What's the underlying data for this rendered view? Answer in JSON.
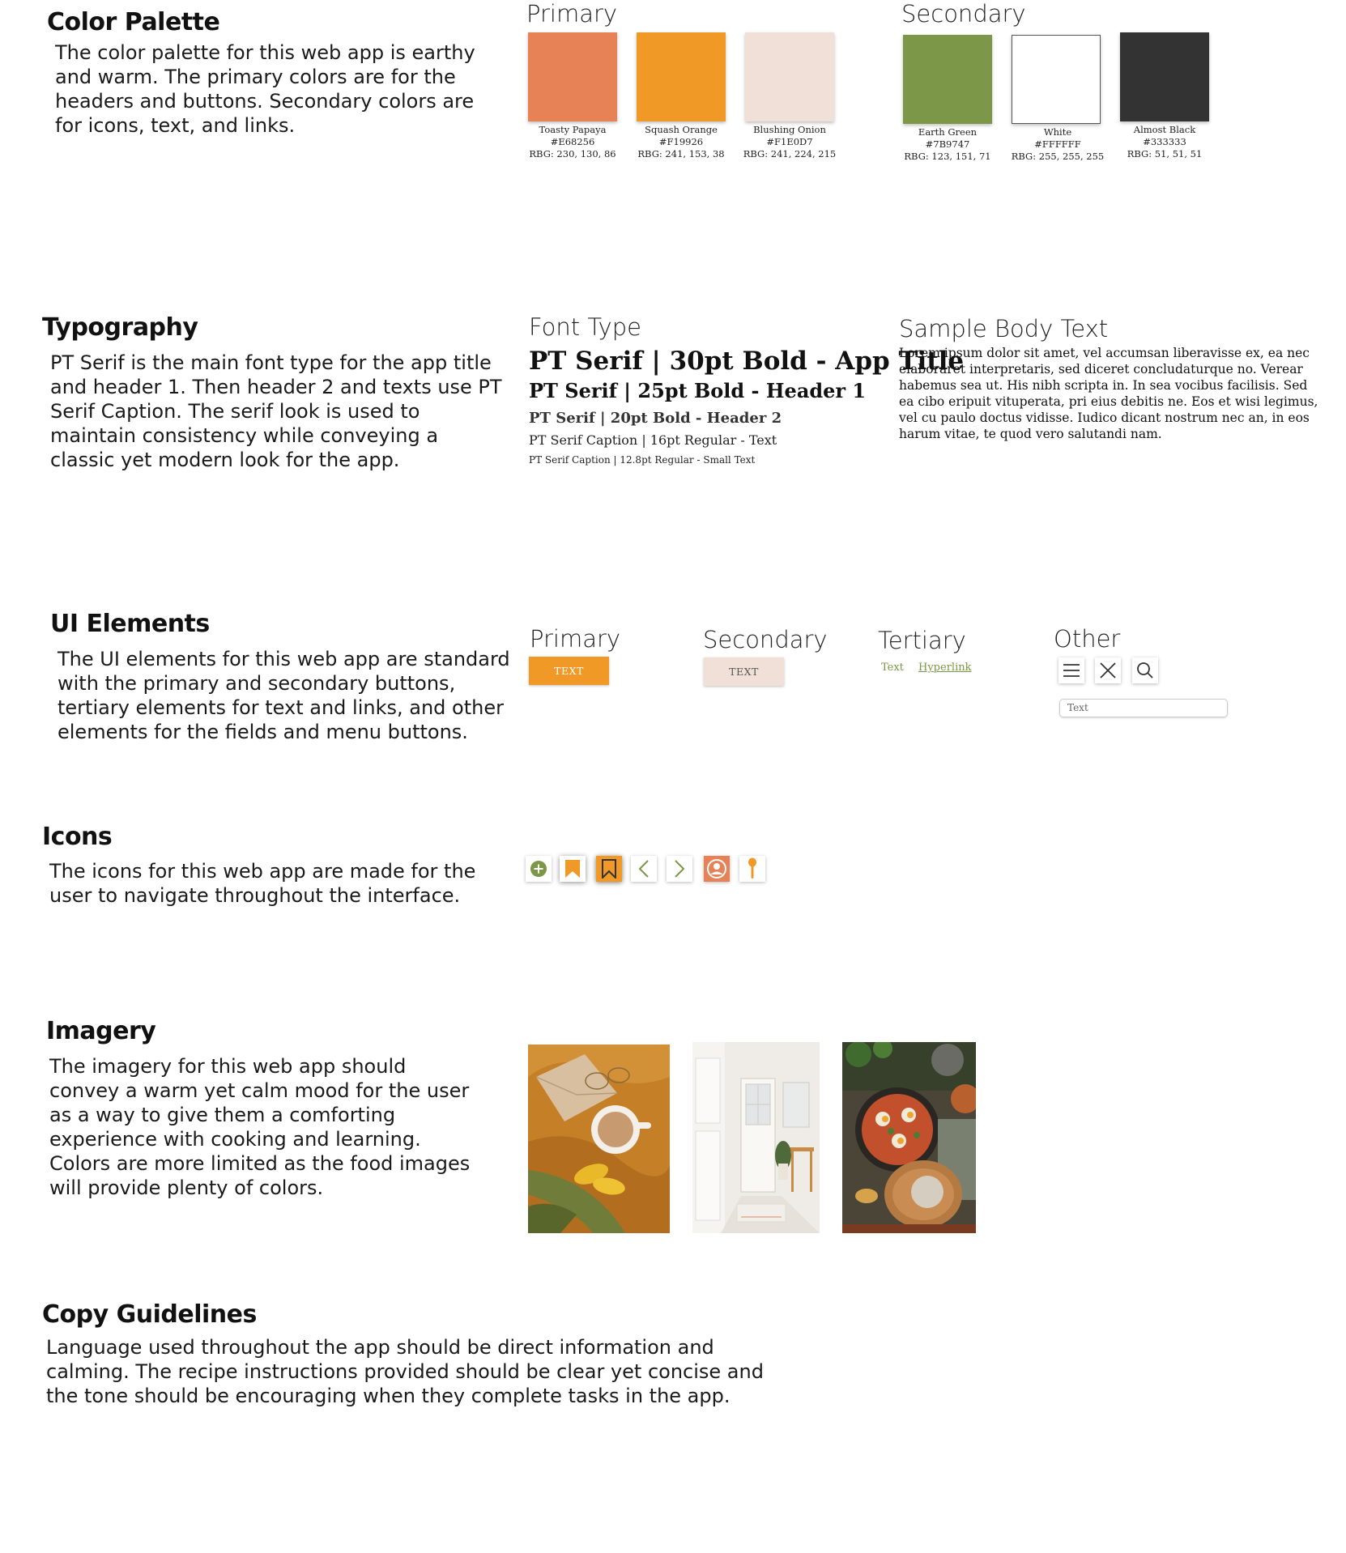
{
  "colors": {
    "toasty_papaya": "#E68256",
    "squash_orange": "#F19926",
    "blushing_onion": "#F1E0D7",
    "earth_green": "#7B9747",
    "white": "#FFFFFF",
    "almost_black": "#333333"
  },
  "color_palette": {
    "title": "Color Palette",
    "description": "The color palette for this web app is earthy and warm. The primary colors are for the headers and buttons. Secondary colors are for icons, text, and links.",
    "primary_heading": "Primary",
    "secondary_heading": "Secondary",
    "primary": [
      {
        "name": "Toasty Papaya",
        "hex": "#E68256",
        "rgb": "RBG: 230, 130, 86"
      },
      {
        "name": "Squash Orange",
        "hex": "#F19926",
        "rgb": "RBG: 241, 153, 38"
      },
      {
        "name": "Blushing Onion",
        "hex": "#F1E0D7",
        "rgb": "RBG: 241, 224, 215"
      }
    ],
    "secondary": [
      {
        "name": "Earth Green",
        "hex": "#7B9747",
        "rgb": "RBG: 123, 151, 71"
      },
      {
        "name": "White",
        "hex": "#FFFFFF",
        "rgb": "RBG: 255, 255, 255"
      },
      {
        "name": "Almost Black",
        "hex": "#333333",
        "rgb": "RBG: 51, 51, 51"
      }
    ]
  },
  "typography": {
    "title": "Typography",
    "description": "PT Serif is the main font type for the app title and header 1. Then header 2 and texts use PT Serif Caption. The serif look is used to maintain consistency while conveying a classic yet modern look for the app.",
    "font_type_heading": "Font Type",
    "samples": [
      "PT Serif | 30pt Bold - App Title",
      "PT Serif | 25pt Bold - Header 1",
      "PT Serif | 20pt Bold - Header 2",
      "PT Serif Caption | 16pt Regular - Text",
      "PT Serif Caption | 12.8pt Regular - Small Text"
    ],
    "sample_body_heading": "Sample Body Text",
    "sample_body": "Lorem ipsum dolor sit amet, vel accumsan liberavisse ex, ea nec elaboraret interpretaris, sed diceret concludaturque no. Verear habemus sea ut. His nibh scripta in. In sea vocibus facilisis. Sed ea cibo eripuit vituperata, pri eius debitis ne. Eos et wisi legimus, vel cu paulo doctus vidisse. Iudico dicant nostrum nec an, in eos harum vitae, te quod vero salutandi nam."
  },
  "ui_elements": {
    "title": "UI Elements",
    "description": "The UI elements for this web app are standard with the primary and secondary buttons, tertiary elements for text and links, and other elements for the fields and menu buttons.",
    "primary_heading": "Primary",
    "secondary_heading": "Secondary",
    "tertiary_heading": "Tertiary",
    "other_heading": "Other",
    "primary_button": "TEXT",
    "secondary_button": "TEXT",
    "tertiary_text": "Text",
    "tertiary_link": "Hyperlink",
    "field_placeholder": "Text",
    "other_icons": [
      "menu-icon",
      "close-icon",
      "search-icon"
    ]
  },
  "icons": {
    "title": "Icons",
    "description": "The icons for this web app are made for the user to navigate throughout the interface.",
    "items": [
      "add-circle-icon",
      "bookmark-icon",
      "bookmark-active-icon",
      "chevron-left-icon",
      "chevron-right-icon",
      "profile-icon",
      "spoon-icon"
    ]
  },
  "imagery": {
    "title": "Imagery",
    "description": "The imagery for this web app should convey a warm yet calm mood for the user as a way to give them a comforting experience with cooking and learning. Colors are more limited as the food images will provide plenty of colors."
  },
  "copy_guidelines": {
    "title": "Copy Guidelines",
    "description": "Language used throughout the app should be direct information and calming. The recipe instructions provided should be clear yet concise and the tone should be encouraging when they complete tasks in the app."
  }
}
